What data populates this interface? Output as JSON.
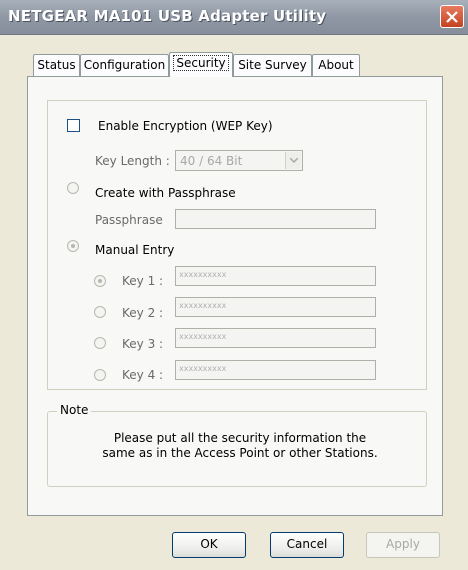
{
  "window": {
    "title": "NETGEAR MA101 USB Adapter Utility"
  },
  "tabs": [
    "Status",
    "Configuration",
    "Security",
    "Site Survey",
    "About"
  ],
  "active_tab": "Security",
  "security": {
    "enable_encryption_label": "Enable Encryption (WEP Key)",
    "enable_encryption_checked": false,
    "key_length_label": "Key Length :",
    "key_length_value": "40 / 64 Bit",
    "create_passphrase_label": "Create with Passphrase",
    "passphrase_label": "Passphrase",
    "passphrase_value": "",
    "manual_entry_label": "Manual Entry",
    "manual_entry_selected": true,
    "keys": [
      {
        "label": "Key 1 :",
        "value": "xxxxxxxxxx",
        "selected": true
      },
      {
        "label": "Key 2 :",
        "value": "xxxxxxxxxx",
        "selected": false
      },
      {
        "label": "Key 3 :",
        "value": "xxxxxxxxxx",
        "selected": false
      },
      {
        "label": "Key 4 :",
        "value": "xxxxxxxxxx",
        "selected": false
      }
    ]
  },
  "note": {
    "label": "Note",
    "line1": "Please put all the security information the",
    "line2": "same as in the Access Point or other Stations."
  },
  "buttons": {
    "ok": "OK",
    "cancel": "Cancel",
    "apply": "Apply"
  }
}
